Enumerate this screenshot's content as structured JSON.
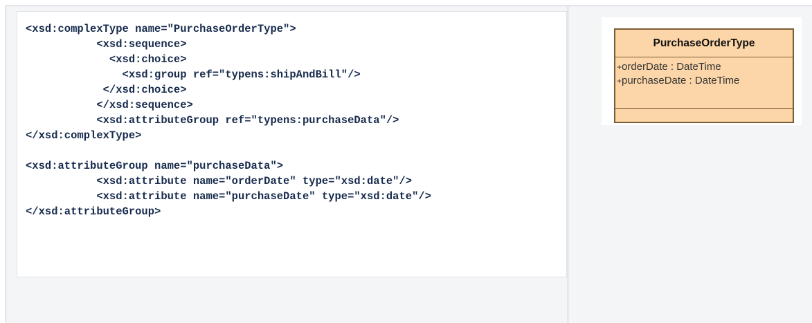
{
  "code": {
    "lines": [
      "<xsd:complexType name=\"PurchaseOrderType\">",
      "           <xsd:sequence>",
      "             <xsd:choice>",
      "               <xsd:group ref=\"typens:shipAndBill\"/>",
      "            </xsd:choice>",
      "           </xsd:sequence>",
      "           <xsd:attributeGroup ref=\"typens:purchaseData\"/>",
      "</xsd:complexType>",
      "",
      "<xsd:attributeGroup name=\"purchaseData\">",
      "           <xsd:attribute name=\"orderDate\" type=\"xsd:date\"/>",
      "           <xsd:attribute name=\"purchaseDate\" type=\"xsd:date\"/>",
      "</xsd:attributeGroup>"
    ]
  },
  "uml_class": {
    "name": "PurchaseOrderType",
    "attributes": [
      {
        "visibility": "+",
        "text": "orderDate : DateTime"
      },
      {
        "visibility": "+",
        "text": "purchaseDate : DateTime"
      }
    ],
    "fill_color": "#fcd6a8",
    "border_color": "#7a5a36"
  }
}
